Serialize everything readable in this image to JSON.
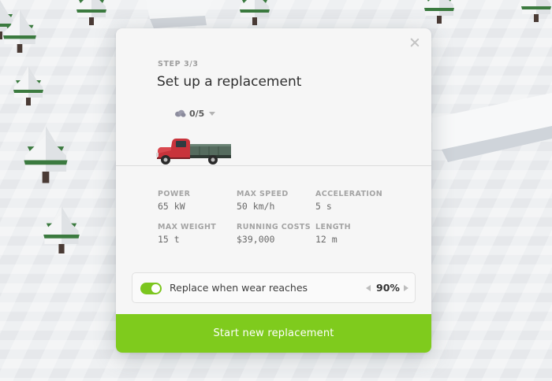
{
  "dialog": {
    "step": "STEP 3/3",
    "title": "Set up a replacement",
    "vehicle_count": "0/5",
    "stats": [
      {
        "label": "POWER",
        "value": "65 kW"
      },
      {
        "label": "MAX SPEED",
        "value": "50 km/h"
      },
      {
        "label": "ACCELERATION",
        "value": "5 s"
      },
      {
        "label": "MAX WEIGHT",
        "value": "15 t"
      },
      {
        "label": "RUNNING COSTS",
        "value": "$39,000"
      },
      {
        "label": "LENGTH",
        "value": "12 m"
      }
    ],
    "wear_toggle": {
      "label": "Replace when wear reaches",
      "enabled": true,
      "value": "90%"
    },
    "start_button": "Start new replacement"
  },
  "icons": {
    "close": "close-icon",
    "vehicle_type": "cloud-icon",
    "dropdown": "chevron-down-icon",
    "decrease": "chevron-left-icon",
    "increase": "chevron-right-icon"
  },
  "colors": {
    "accent": "#7fcb1d",
    "toggle_on": "#7cc61f",
    "truck_cab": "#c9343c",
    "truck_bed": "#4f6f5f"
  }
}
